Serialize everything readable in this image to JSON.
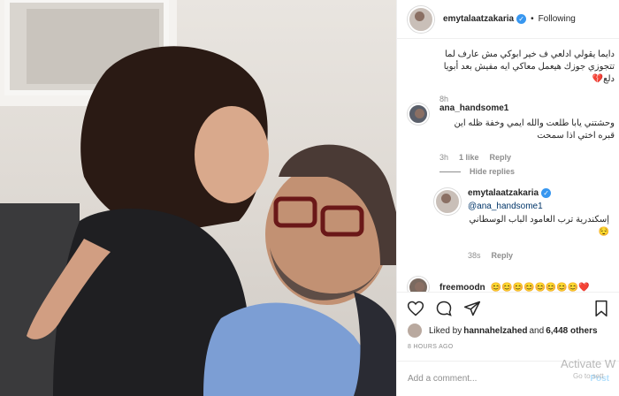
{
  "post": {
    "author": "emytalaatzakaria",
    "follow_status": "Following",
    "separator": "•"
  },
  "comments": [
    {
      "text": "دايما يقولي ادلعي ف خير ابوكي مش عارف لما تتجوزي جوزك هيعمل معاكي ايه مفيش بعد أبويا دلع💔",
      "age": "8h"
    },
    {
      "author": "ana_handsome1",
      "text": "وحشتني يابا طلعت والله ايمي وخفة ظله اين قبره اختي اذا سمحت",
      "age": "3h",
      "likes": "1 like",
      "reply": "Reply",
      "hide_replies": "Hide replies"
    },
    {
      "author": "emytalaatzakaria",
      "mention": "@ana_handsome1",
      "text": "إسكندرية ترب العامود الباب الوسطاني😌",
      "age": "38s",
      "reply": "Reply"
    },
    {
      "author": "freemoodn",
      "text": "😊😊😊😊😊😊😊😊❤️"
    }
  ],
  "actions": {
    "icons": [
      "heart-icon",
      "comment-icon",
      "share-icon",
      "bookmark-icon"
    ]
  },
  "likes": {
    "prefix": "Liked by",
    "user": "hannahelzahed",
    "and": "and",
    "others": "6,448 others"
  },
  "timestamp": "8 HOURS AGO",
  "add_comment": {
    "placeholder": "Add a comment...",
    "post_label": "Post"
  },
  "watermark": {
    "line1": "Activate W",
    "line2": "Go to sett"
  },
  "colors": {
    "verified": "#3897f0",
    "link": "#003569",
    "muted": "#8e8e8e",
    "post_disabled": "#b2dffc"
  }
}
